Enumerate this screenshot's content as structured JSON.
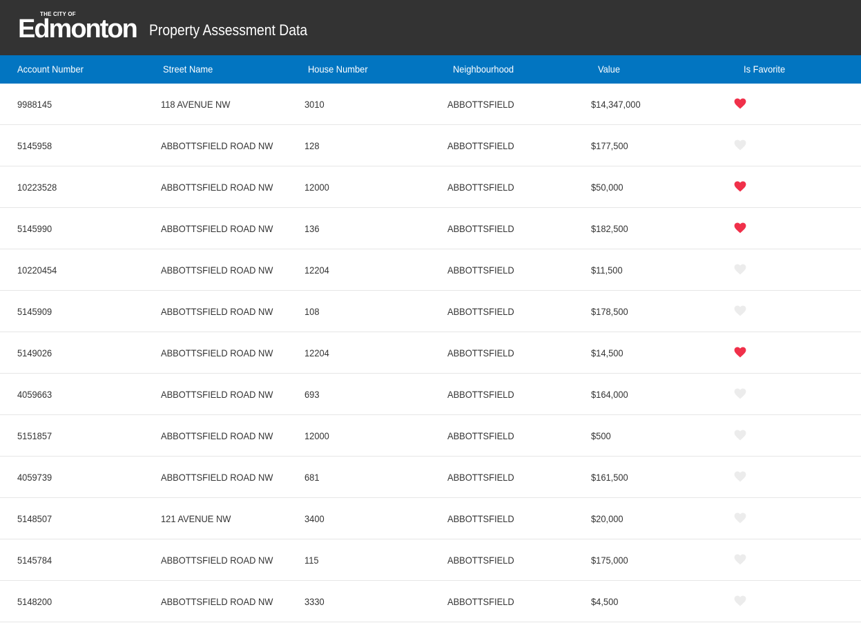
{
  "header": {
    "logo_small": "THE CITY OF",
    "logo_big": "Edmonton",
    "title": "Property Assessment Data"
  },
  "columns": [
    "Account Number",
    "Street Name",
    "House Number",
    "Neighbourhood",
    "Value",
    "Is Favorite"
  ],
  "colors": {
    "topbar": "#333333",
    "header": "#0275c1",
    "favorite_on": "#f0304a",
    "favorite_off": "#ececec"
  },
  "rows": [
    {
      "account": "9988145",
      "street": "118 AVENUE NW",
      "house": "3010",
      "neighbourhood": "ABBOTTSFIELD",
      "value": "$14,347,000",
      "favorite": true
    },
    {
      "account": "5145958",
      "street": "ABBOTTSFIELD ROAD NW",
      "house": "128",
      "neighbourhood": "ABBOTTSFIELD",
      "value": "$177,500",
      "favorite": false
    },
    {
      "account": "10223528",
      "street": "ABBOTTSFIELD ROAD NW",
      "house": "12000",
      "neighbourhood": "ABBOTTSFIELD",
      "value": "$50,000",
      "favorite": true
    },
    {
      "account": "5145990",
      "street": "ABBOTTSFIELD ROAD NW",
      "house": "136",
      "neighbourhood": "ABBOTTSFIELD",
      "value": "$182,500",
      "favorite": true
    },
    {
      "account": "10220454",
      "street": "ABBOTTSFIELD ROAD NW",
      "house": "12204",
      "neighbourhood": "ABBOTTSFIELD",
      "value": "$11,500",
      "favorite": false
    },
    {
      "account": "5145909",
      "street": "ABBOTTSFIELD ROAD NW",
      "house": "108",
      "neighbourhood": "ABBOTTSFIELD",
      "value": "$178,500",
      "favorite": false
    },
    {
      "account": "5149026",
      "street": "ABBOTTSFIELD ROAD NW",
      "house": "12204",
      "neighbourhood": "ABBOTTSFIELD",
      "value": "$14,500",
      "favorite": true
    },
    {
      "account": "4059663",
      "street": "ABBOTTSFIELD ROAD NW",
      "house": "693",
      "neighbourhood": "ABBOTTSFIELD",
      "value": "$164,000",
      "favorite": false
    },
    {
      "account": "5151857",
      "street": "ABBOTTSFIELD ROAD NW",
      "house": "12000",
      "neighbourhood": "ABBOTTSFIELD",
      "value": "$500",
      "favorite": false
    },
    {
      "account": "4059739",
      "street": "ABBOTTSFIELD ROAD NW",
      "house": "681",
      "neighbourhood": "ABBOTTSFIELD",
      "value": "$161,500",
      "favorite": false
    },
    {
      "account": "5148507",
      "street": "121 AVENUE NW",
      "house": "3400",
      "neighbourhood": "ABBOTTSFIELD",
      "value": "$20,000",
      "favorite": false
    },
    {
      "account": "5145784",
      "street": "ABBOTTSFIELD ROAD NW",
      "house": "115",
      "neighbourhood": "ABBOTTSFIELD",
      "value": "$175,000",
      "favorite": false
    },
    {
      "account": "5148200",
      "street": "ABBOTTSFIELD ROAD NW",
      "house": "3330",
      "neighbourhood": "ABBOTTSFIELD",
      "value": "$4,500",
      "favorite": false
    }
  ]
}
